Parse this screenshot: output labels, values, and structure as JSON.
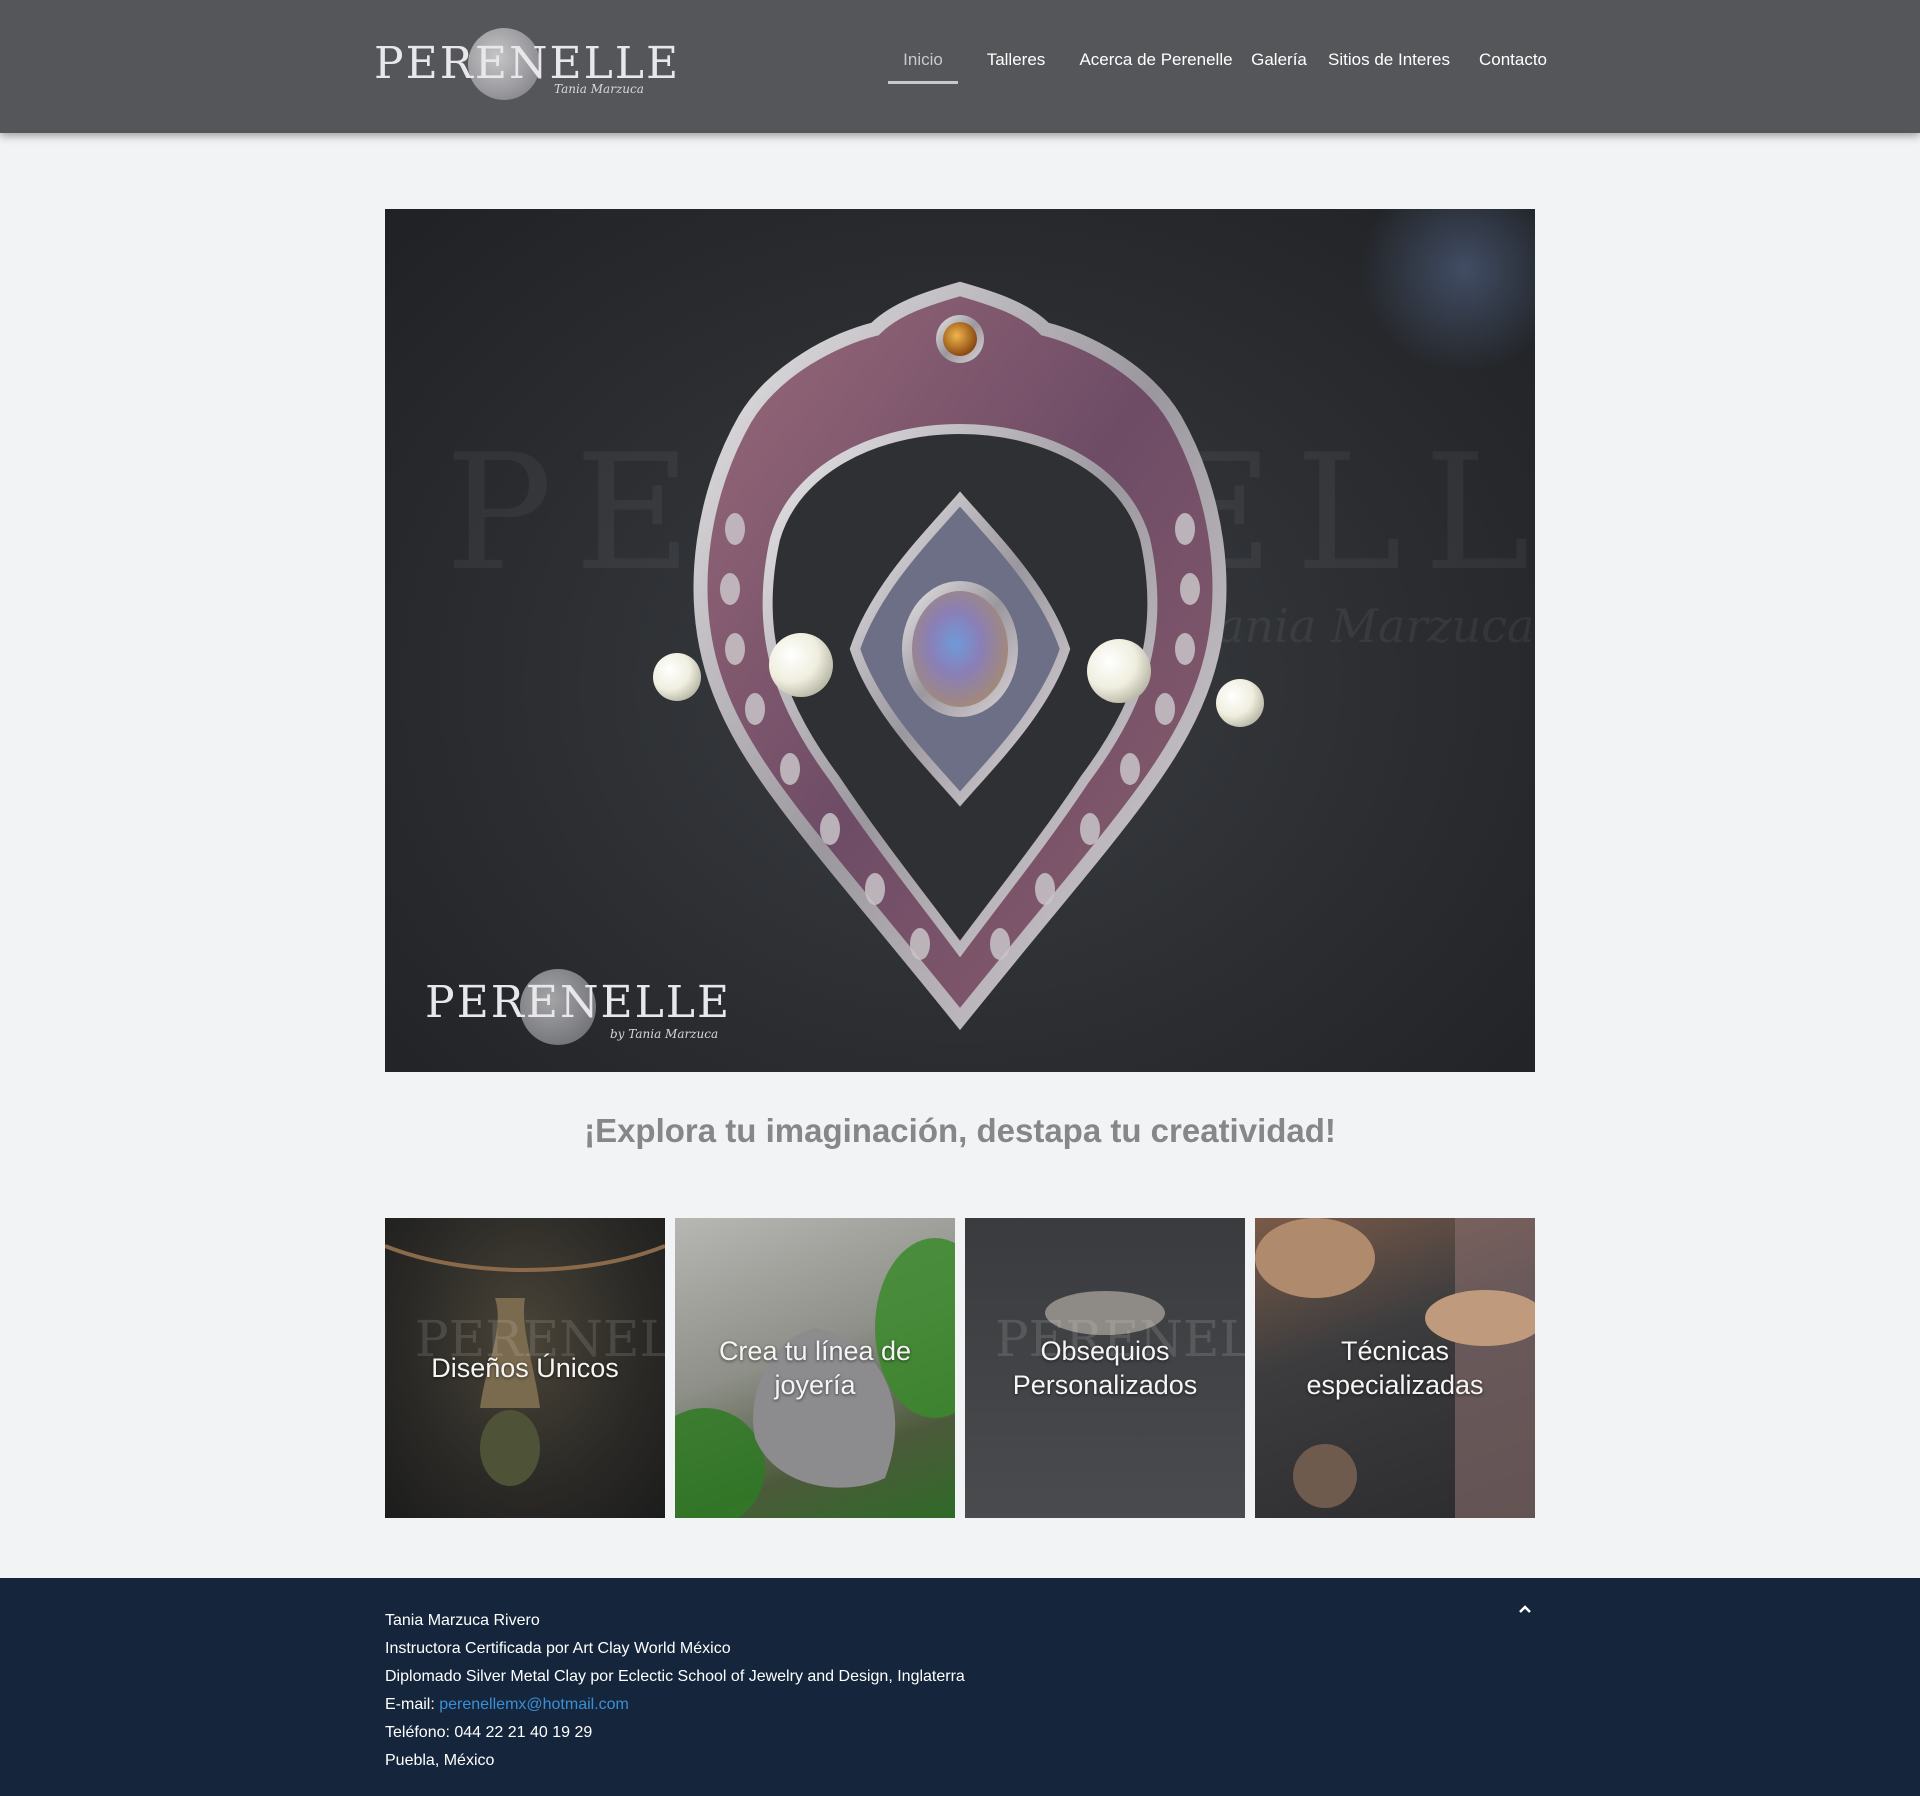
{
  "header": {
    "logo_text": "PERENELLE",
    "logo_signature": "Tania Marzuca",
    "nav": [
      {
        "label": "Inicio",
        "active": true
      },
      {
        "label": "Talleres"
      },
      {
        "label": "Acerca de Perenelle"
      },
      {
        "label": "Galería"
      },
      {
        "label": "Sitios de Interes"
      },
      {
        "label": "Contacto"
      }
    ]
  },
  "hero": {
    "watermark": "PERENELLE",
    "watermark_signature": "Tania Marzuca",
    "logo_text": "PERENELLE",
    "logo_signature": "by Tania Marzuca"
  },
  "tagline": "¡Explora tu imaginación, destapa tu creatividad!",
  "tiles": [
    {
      "label": "Diseños Únicos",
      "watermark": "PERENELLE"
    },
    {
      "label": "Crea tu línea de joyería"
    },
    {
      "label": "Obsequios Personalizados",
      "watermark": "PERENELLE"
    },
    {
      "label": "Técnicas especializadas"
    }
  ],
  "footer": {
    "name": "Tania Marzuca Rivero",
    "line1": "Instructora Certificada por Art Clay World México",
    "line2": "Diplomado Silver Metal Clay por Eclectic School of Jewelry and Design, Inglaterra",
    "email_label": "E-mail: ",
    "email": "perenellemx@hotmail.com",
    "phone": "Teléfono: 044 22 21 40 19 29",
    "location": "Puebla, México"
  },
  "colors": {
    "header_bg": "#555659",
    "page_bg": "#f2f3f4",
    "footer_bg": "#15253b",
    "link": "#3b8fd6",
    "tagline": "#85878a"
  },
  "icons": {
    "to_top": "chevron-up-icon"
  }
}
